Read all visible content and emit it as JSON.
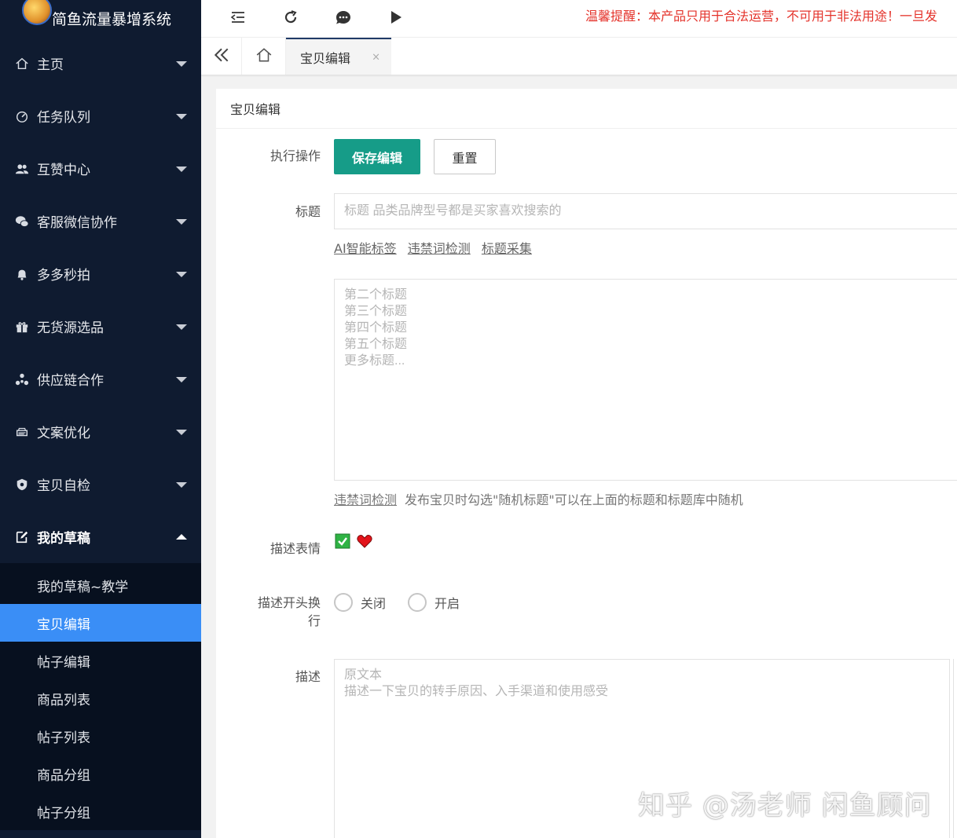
{
  "app": {
    "title": "简鱼流量暴增系统",
    "notice": "温馨提醒：本产品只用于合法运营，不可用于非法用途！一旦发"
  },
  "sidebar": {
    "items": [
      {
        "label": "主页",
        "icon": "home-icon"
      },
      {
        "label": "任务队列",
        "icon": "gauge-icon"
      },
      {
        "label": "互赞中心",
        "icon": "users-icon"
      },
      {
        "label": "客服微信协作",
        "icon": "wechat-icon"
      },
      {
        "label": "多多秒拍",
        "icon": "bell-icon"
      },
      {
        "label": "无货源选品",
        "icon": "gift-icon"
      },
      {
        "label": "供应链合作",
        "icon": "network-icon"
      },
      {
        "label": "文案优化",
        "icon": "printer-icon"
      },
      {
        "label": "宝贝自检",
        "icon": "shield-icon"
      },
      {
        "label": "我的草稿",
        "icon": "edit-icon",
        "open": true
      }
    ],
    "submenu": [
      {
        "label": "我的草稿~教学"
      },
      {
        "label": "宝贝编辑",
        "active": true
      },
      {
        "label": "帖子编辑"
      },
      {
        "label": "商品列表"
      },
      {
        "label": "帖子列表"
      },
      {
        "label": "商品分组"
      },
      {
        "label": "帖子分组"
      }
    ]
  },
  "tabs": {
    "active_tab": "宝贝编辑",
    "close_glyph": "×"
  },
  "form": {
    "card_title": "宝贝编辑",
    "action_label": "执行操作",
    "save_label": "保存编辑",
    "reset_label": "重置",
    "title_label": "标题",
    "title_placeholder": "标题 品类品牌型号都是买家喜欢搜索的",
    "title_links": [
      "AI智能标签",
      "违禁词检测",
      "标题采集"
    ],
    "more_titles_placeholder": "第二个标题\n第三个标题\n第四个标题\n第五个标题\n更多标题...",
    "hint_link": "违禁词检测",
    "hint_text": "发布宝贝时勾选\"随机标题\"可以在上面的标题和标题库中随机",
    "emoji_label": "描述表情",
    "linebreak_label_1": "描述开头换",
    "linebreak_label_2": "行",
    "radio_off": "关闭",
    "radio_on": "开启",
    "desc_label": "描述",
    "desc_placeholder": "原文本\n描述一下宝贝的转手原因、入手渠道和使用感受"
  },
  "watermark": "知乎 @汤老师 闲鱼顾问",
  "colors": {
    "sidebar_bg": "#0f1b30",
    "active_item": "#3a8ef6",
    "primary_button": "#169c88",
    "notice_text": "#e4332b"
  }
}
